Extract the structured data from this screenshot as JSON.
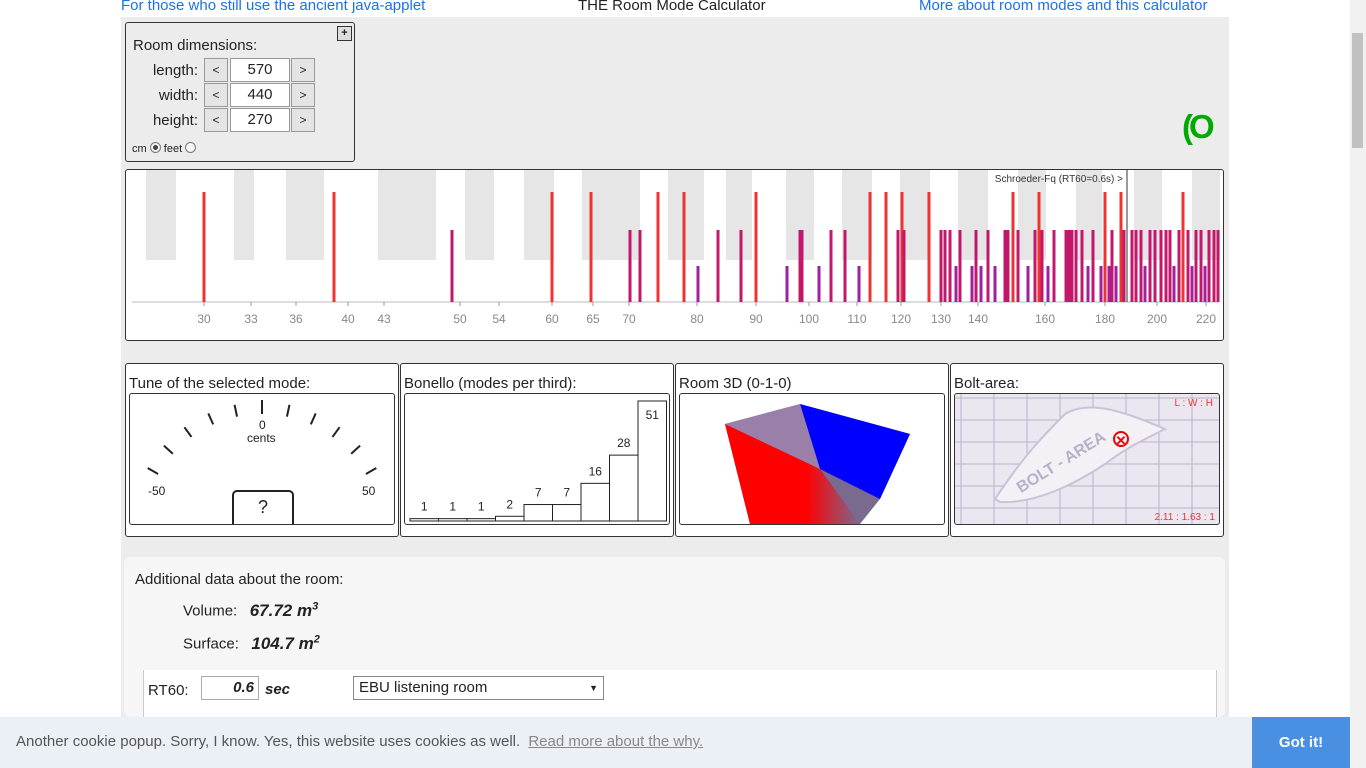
{
  "header": {
    "left_link": "For those who still use the ancient java-applet",
    "title": "THE Room Mode Calculator",
    "right_link": "More about room modes and this calculator"
  },
  "dimensions": {
    "title": "Room dimensions:",
    "plus": "+",
    "rows": [
      {
        "label": "length:",
        "value": "570",
        "dec": "<",
        "inc": ">"
      },
      {
        "label": "width:",
        "value": "440",
        "dec": "<",
        "inc": ">"
      },
      {
        "label": "height:",
        "value": "270",
        "dec": "<",
        "inc": ">"
      }
    ],
    "unit_cm": "cm",
    "unit_feet": "feet",
    "selected_unit": "cm"
  },
  "spinner_text": "(O",
  "spectrum": {
    "schroeder_label": "Schroeder-Fq (RT60=0.6s) >",
    "ticks": [
      "30",
      "33",
      "36",
      "40",
      "43",
      "50",
      "54",
      "60",
      "65",
      "70",
      "80",
      "90",
      "100",
      "110",
      "120",
      "130",
      "140",
      "160",
      "180",
      "200",
      "220"
    ]
  },
  "panels": {
    "tune": {
      "title": "Tune of the selected mode:",
      "zero": "0",
      "cents": "cents",
      "min": "-50",
      "max": "50",
      "value": "?"
    },
    "bonello": {
      "title": "Bonello (modes per third):",
      "values": [
        1,
        1,
        1,
        2,
        7,
        7,
        16,
        28,
        51
      ]
    },
    "room3d": {
      "title": "Room 3D (0-1-0)"
    },
    "bolt": {
      "title": "Bolt-area:",
      "ratio_label": "L : W : H",
      "ratio": "2.11 : 1.63 : 1",
      "watermark": "BOLT - AREA"
    }
  },
  "additional": {
    "title": "Additional data about the room:",
    "volume_label": "Volume:",
    "volume_value": "67.72 m",
    "volume_sup": "3",
    "surface_label": "Surface:",
    "surface_value": "104.7 m",
    "surface_sup": "2",
    "rt60_label": "RT60:",
    "rt60_value": "0.6",
    "rt60_unit": "sec",
    "room_type": "EBU listening room"
  },
  "cookie": {
    "message": "Another cookie popup. Sorry, I know. Yes, this website uses cookies as well.",
    "more": "Read more about the why.",
    "button": "Got it!"
  }
}
